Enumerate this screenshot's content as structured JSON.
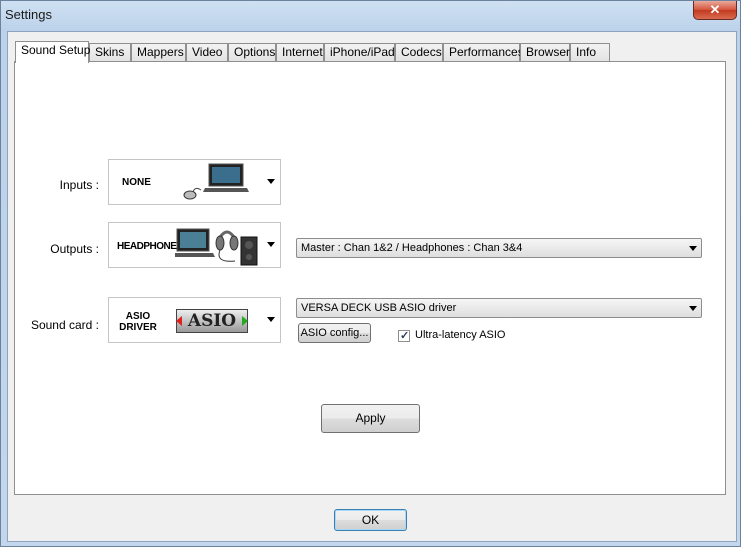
{
  "window": {
    "title": "Settings",
    "close_label": "✕"
  },
  "tabs": [
    {
      "label": "Sound Setup"
    },
    {
      "label": "Skins"
    },
    {
      "label": "Mappers"
    },
    {
      "label": "Video"
    },
    {
      "label": "Options"
    },
    {
      "label": "Internet"
    },
    {
      "label": "iPhone/iPad"
    },
    {
      "label": "Codecs"
    },
    {
      "label": "Performances"
    },
    {
      "label": "Browser"
    },
    {
      "label": "Info"
    }
  ],
  "sound_setup": {
    "inputs": {
      "label": "Inputs :",
      "device_text": "NONE"
    },
    "outputs": {
      "label": "Outputs :",
      "device_text": "HEADPHONES",
      "routing_value": "Master : Chan 1&2 / Headphones : Chan 3&4"
    },
    "sound_card": {
      "label": "Sound card :",
      "device_text_line1": "ASIO",
      "device_text_line2": "DRIVER",
      "logo_text": "ASIO",
      "driver_value": "VERSA DECK USB ASIO driver",
      "config_label": "ASIO config...",
      "ultra_latency_label": "Ultra-latency ASIO",
      "ultra_latency_checked": true
    },
    "apply_label": "Apply"
  },
  "footer": {
    "ok_label": "OK"
  }
}
